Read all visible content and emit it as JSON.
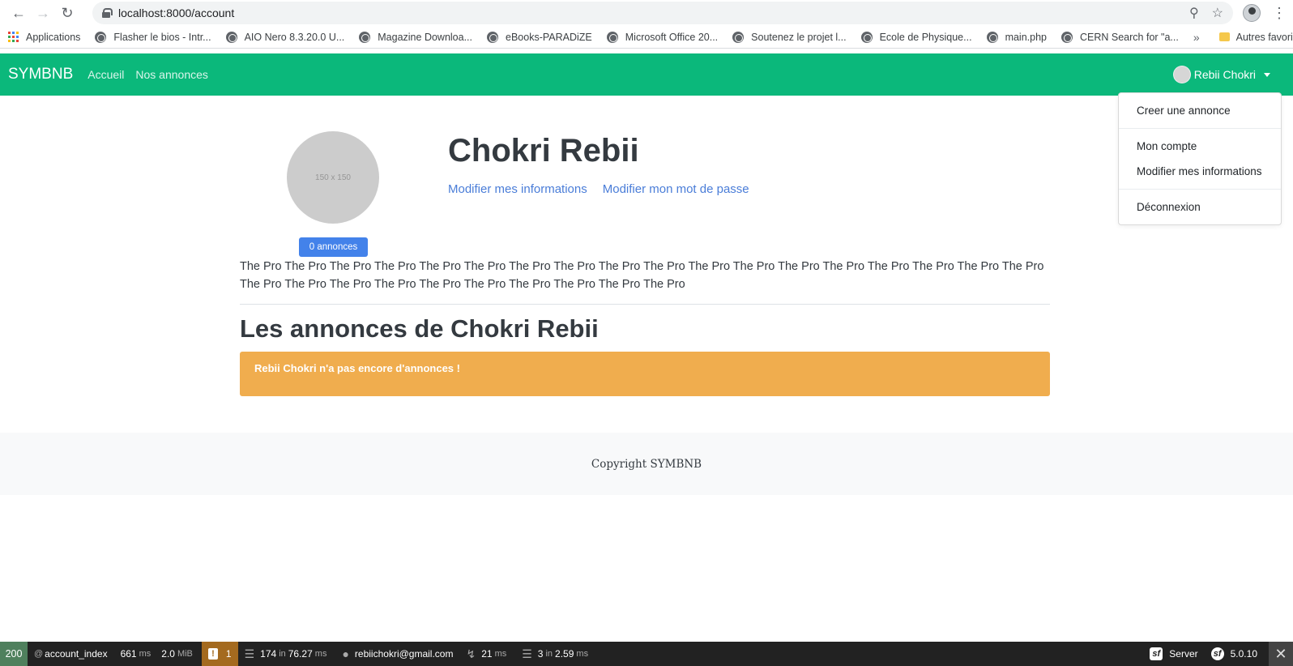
{
  "browser": {
    "url": "localhost:8000/account",
    "bookmarks": [
      "Applications",
      "Flasher le bios - Intr...",
      "AIO Nero 8.3.20.0 U...",
      "Magazine Downloa...",
      "eBooks-PARADiZE",
      "Microsoft Office 20...",
      "Soutenez le projet l...",
      "Ecole de Physique...",
      "main.php",
      "CERN Search for \"a..."
    ],
    "more": "»",
    "other_bookmarks": "Autres favoris"
  },
  "navbar": {
    "brand": "SYMBNB",
    "links": [
      "Accueil",
      "Nos annonces"
    ],
    "user_name": "Rebii Chokri",
    "bg_color": "#0bb87b"
  },
  "dropdown": {
    "create": "Creer une annonce",
    "account": "Mon compte",
    "edit_info": "Modifier mes informations",
    "logout": "Déconnexion"
  },
  "profile": {
    "avatar_placeholder": "150 x 150",
    "ads_badge": "0 annonces",
    "name": "Chokri Rebii",
    "link_edit_info": "Modifier mes informations",
    "link_edit_password": "Modifier mon mot de passe",
    "bio": "The Pro The Pro The Pro The Pro The Pro The Pro The Pro The Pro The Pro The Pro The Pro The Pro The Pro The Pro The Pro The Pro The Pro The Pro The Pro The Pro The Pro The Pro The Pro The Pro The Pro The Pro The Pro The Pro"
  },
  "ads_section": {
    "title": "Les annonces de Chokri Rebii",
    "empty_alert": "Rebii Chokri n'a pas encore d'annonces !"
  },
  "footer": {
    "copyright": "Copyright SYMBNB"
  },
  "symfony_toolbar": {
    "status": "200",
    "route": "account_index",
    "time_value": "661",
    "time_unit": "ms",
    "memory_value": "2.0",
    "memory_unit": "MiB",
    "warnings": "1",
    "twig_count": "174",
    "twig_in": "in",
    "twig_time": "76.27",
    "twig_unit": "ms",
    "user": "rebiichokri@gmail.com",
    "events_time": "21",
    "events_unit": "ms",
    "db_count": "3",
    "db_in": "in",
    "db_time": "2.59",
    "db_unit": "ms",
    "server": "Server",
    "version": "5.0.10"
  }
}
